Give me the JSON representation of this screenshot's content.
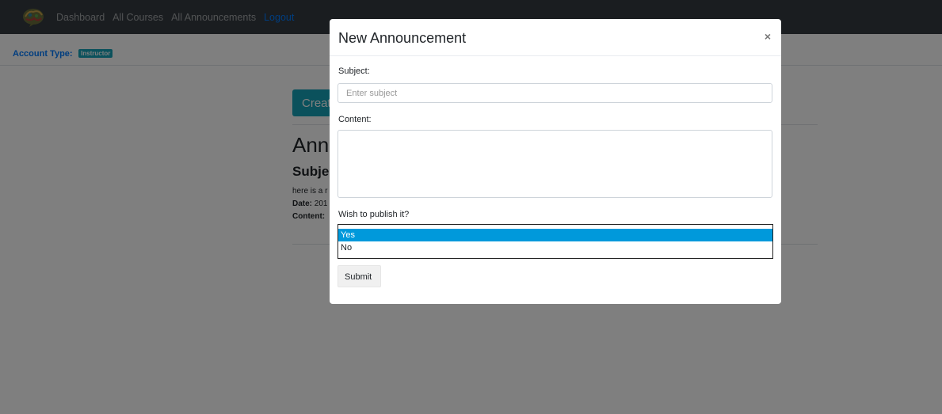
{
  "navbar": {
    "links": [
      "Dashboard",
      "All Courses",
      "All Announcements"
    ],
    "logout_label": "Logout"
  },
  "account": {
    "label": "Account Type:",
    "badge": "Instructor"
  },
  "background_page": {
    "create_button": "Creat",
    "title": "Anno",
    "subject": "Subje",
    "body_line": "here is a r",
    "date_label": "Date:",
    "date_value": "201",
    "content_label": "Content:"
  },
  "modal": {
    "title": "New Announcement",
    "close": "×",
    "subject_label": "Subject:",
    "subject_placeholder": "Enter subject",
    "subject_value": "",
    "content_label": "Content:",
    "content_value": "",
    "publish_label": "Wish to publish it?",
    "publish_options": [
      "Yes",
      "No"
    ],
    "publish_selected": "Yes",
    "submit_label": "Submit"
  },
  "colors": {
    "navbar_bg": "#343a40",
    "link_blue": "#007bff",
    "badge_teal": "#17a2b8",
    "selected_option": "#0099db"
  }
}
